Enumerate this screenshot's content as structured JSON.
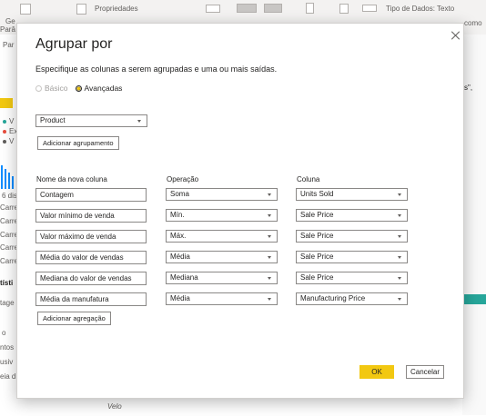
{
  "background": {
    "ribbon": {
      "properties_label": "Propriedades",
      "datatype_label": "Tipo de Dados: Texto",
      "right_label": "como",
      "left_top": "Ge",
      "left_params": "Parâ",
      "left_params2": "Par"
    },
    "left_panel": {
      "v1": "V",
      "v2": "Ex",
      "v3": "V",
      "dist": "6 dis",
      "rows": [
        "Carre",
        "Carre",
        "Carre",
        "Carre",
        "Carre"
      ],
      "stats": "tísti",
      "tage": "tage",
      "o": "o",
      "ntos": "ntos",
      "usiv": "usiv",
      "eia": "eia d"
    },
    "right_quote": "s\",",
    "bottom_label": "Velo"
  },
  "dialog": {
    "title": "Agrupar por",
    "description": "Especifique as colunas a serem agrupadas e uma ou mais saídas.",
    "radio_basic": "Básico",
    "radio_advanced": "Avançadas",
    "group_column": "Product",
    "add_grouping": "Adicionar agrupamento",
    "headers": {
      "name": "Nome da nova coluna",
      "operation": "Operação",
      "column": "Coluna"
    },
    "aggregations": [
      {
        "name": "Contagem",
        "operation": "Soma",
        "column": "Units Sold"
      },
      {
        "name": "Valor mínimo de venda",
        "operation": "Mín.",
        "column": "Sale Price"
      },
      {
        "name": "Valor máximo de venda",
        "operation": "Máx.",
        "column": "Sale Price"
      },
      {
        "name": "Média do valor de vendas",
        "operation": "Média",
        "column": "Sale Price"
      },
      {
        "name": "Mediana do valor de vendas",
        "operation": "Mediana",
        "column": "Sale Price"
      },
      {
        "name": "Média da manufatura",
        "operation": "Média",
        "column": "Manufacturing Price"
      }
    ],
    "add_aggregation": "Adicionar agregação",
    "ok": "OK",
    "cancel": "Cancelar"
  },
  "colors": {
    "accent": "#f2c811",
    "bars": "#118dff"
  }
}
